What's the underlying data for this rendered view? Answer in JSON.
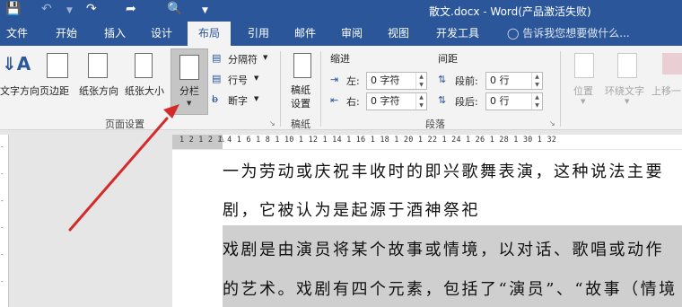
{
  "title_bar": {
    "document_title": "散文.docx - Word(产品激活失败)"
  },
  "tabs": [
    {
      "label": "文件"
    },
    {
      "label": "开始"
    },
    {
      "label": "插入"
    },
    {
      "label": "设计"
    },
    {
      "label": "布局"
    },
    {
      "label": "引用"
    },
    {
      "label": "邮件"
    },
    {
      "label": "审阅"
    },
    {
      "label": "视图"
    },
    {
      "label": "开发工具"
    }
  ],
  "active_tab": "布局",
  "tell_me": "告诉我您想要做什么...",
  "page_setup": {
    "text_direction": "文字方向",
    "margins": "页边距",
    "orientation": "纸张方向",
    "size": "纸张大小",
    "columns": "分栏",
    "breaks": "分隔符",
    "line_numbers": "行号",
    "hyphenation": "断字",
    "group_label": "页面设置"
  },
  "manuscript": {
    "button": "稿纸\n设置",
    "group_label": "稿纸"
  },
  "paragraph": {
    "indent_header": "缩进",
    "spacing_header": "间距",
    "left_label": "左:",
    "right_label": "右:",
    "left_value": "0 字符",
    "right_value": "0 字符",
    "before_label": "段前:",
    "after_label": "段后:",
    "before_value": "0 行",
    "after_value": "0 行",
    "group_label": "段落"
  },
  "arrange": {
    "position": "位置",
    "wrap_text": "环绕文字",
    "bring_forward": "上移一"
  },
  "ruler": {
    "marks": "1 2 1     2 1   4 1   6 1   8 1  10 1  12 1  14 1  16 1  18 1  20 1  22 1  24 1  26 1  28 1  30 1  32"
  },
  "document": {
    "lines": [
      "一为劳动或庆祝丰收时的即兴歌舞表演，这种说法主要",
      "剧，它被认为是起源于酒神祭祀",
      "戏剧是由演员将某个故事或情境，以对话、歌唱或动作",
      "的艺术。戏剧有四个元素，包括了“演员”、“故事（情境"
    ]
  },
  "colors": {
    "brand": "#2b579a",
    "arrow": "#d42a2a",
    "highlight": "#cfcfcf"
  }
}
